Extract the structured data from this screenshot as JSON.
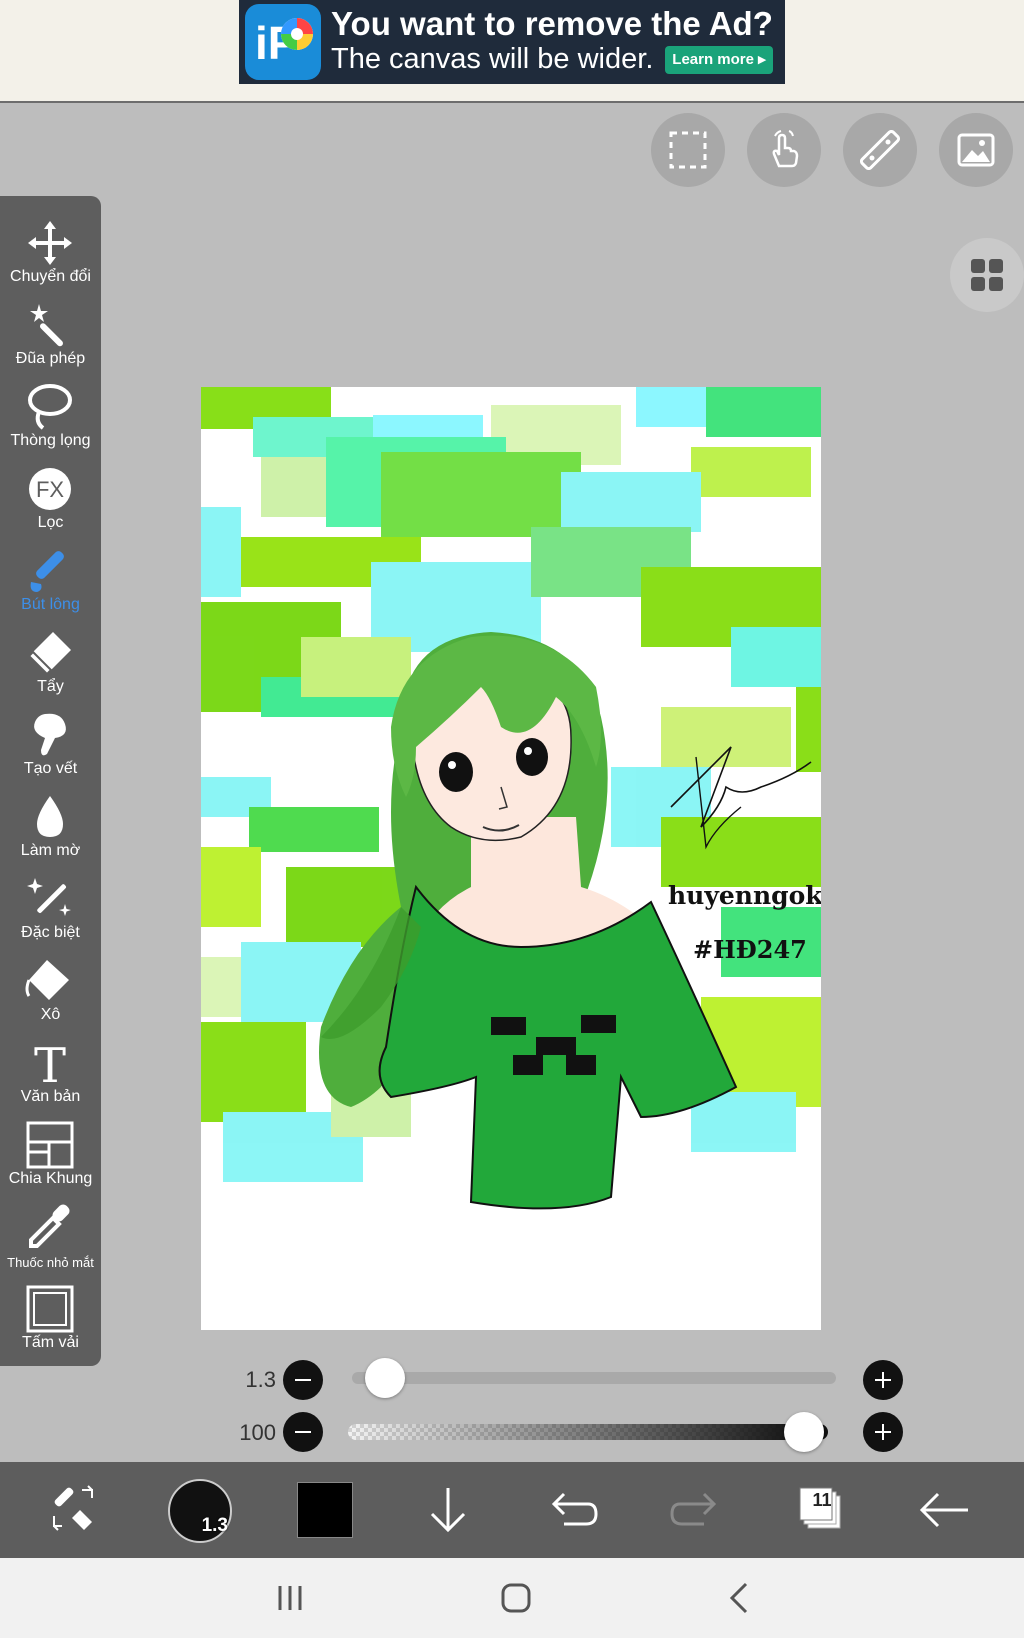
{
  "ad": {
    "logo_text": "iP",
    "title": "You want to remove the Ad?",
    "subtitle": "The canvas will be wider.",
    "button": "Learn more ▸"
  },
  "top_buttons": [
    "selection-icon",
    "touch-gesture-icon",
    "ruler-icon",
    "image-import-icon"
  ],
  "tools": [
    {
      "name": "move",
      "icon": "move-icon",
      "label": "Chuyển đổi"
    },
    {
      "name": "magic-wand",
      "icon": "magic-wand-icon",
      "label": "Đũa phép"
    },
    {
      "name": "lasso",
      "icon": "lasso-icon",
      "label": "Thòng lọng"
    },
    {
      "name": "filter",
      "icon": "fx-icon",
      "label": "Lọc"
    },
    {
      "name": "brush",
      "icon": "brush-icon",
      "label": "Bút lông",
      "active": true
    },
    {
      "name": "eraser",
      "icon": "eraser-icon",
      "label": "Tẩy"
    },
    {
      "name": "smudge",
      "icon": "smudge-icon",
      "label": "Tạo vết"
    },
    {
      "name": "blur",
      "icon": "drop-icon",
      "label": "Làm mờ"
    },
    {
      "name": "special",
      "icon": "sparkle-wand-icon",
      "label": "Đặc biệt"
    },
    {
      "name": "fill",
      "icon": "bucket-icon",
      "label": "Xô"
    },
    {
      "name": "text",
      "icon": "text-icon",
      "label": "Văn bản"
    },
    {
      "name": "frame-divider",
      "icon": "frame-divider-icon",
      "label": "Chia Khung"
    },
    {
      "name": "eyedropper",
      "icon": "eyedropper-icon",
      "label": "Thuốc nhỏ mắt"
    },
    {
      "name": "canvas",
      "icon": "canvas-icon",
      "label": "Tấm vải"
    }
  ],
  "artwork": {
    "signature_name": "huyenngok",
    "hashtag": "#HĐ247",
    "colors": {
      "green": "#37b24d",
      "lime": "#8ee000",
      "cyan": "#7ff5f5",
      "hair": "#4fae3c"
    }
  },
  "sliders": {
    "size": {
      "value": "1.3",
      "level": 0.03
    },
    "opacity": {
      "value": "100",
      "level": 1.0
    }
  },
  "bottom": {
    "brush_size": "1.3",
    "color": "#000000",
    "layer_count": "11"
  },
  "colors": {
    "toolbar": "#5e5e5e",
    "accent": "#3d8fe8",
    "workspace": "#bdbdbd"
  }
}
